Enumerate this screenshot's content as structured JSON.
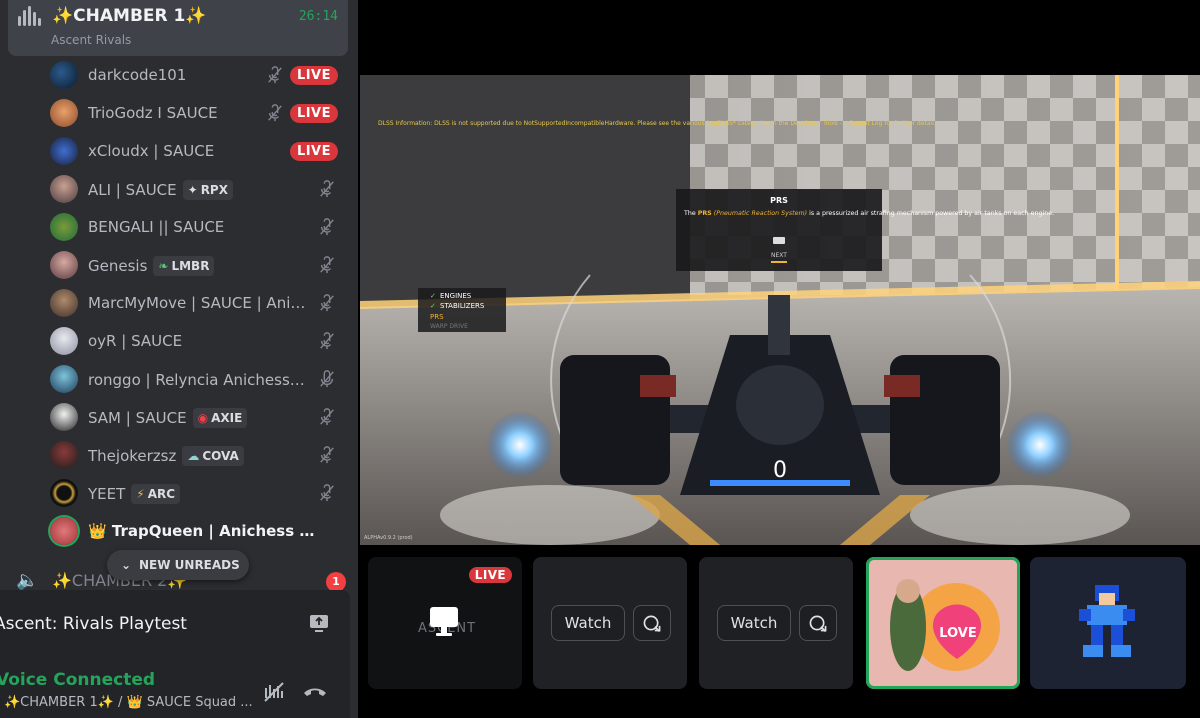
{
  "voice_channel": {
    "name": "✨CHAMBER 1✨",
    "timer": "26:14",
    "activity": "Ascent Rivals"
  },
  "members": [
    {
      "name": "darkcode101",
      "tag": "",
      "tag_glyph": "",
      "live": "LIVE",
      "muted": true
    },
    {
      "name": "TrioGodz I SAUCE",
      "tag": "",
      "tag_glyph": "",
      "live": "LIVE",
      "muted": true
    },
    {
      "name": "xCloudx | SAUCE",
      "tag": "",
      "tag_glyph": "",
      "live": "LIVE",
      "muted": false
    },
    {
      "name": "ALI | SAUCE",
      "tag": "RPX",
      "tag_glyph": "✦",
      "live": "",
      "muted": true
    },
    {
      "name": "BENGALI || SAUCE",
      "tag": "",
      "tag_glyph": "",
      "live": "",
      "muted": true
    },
    {
      "name": "Genesis",
      "tag": "LMBR",
      "tag_glyph": "❧",
      "live": "",
      "muted": true
    },
    {
      "name": "MarcMyMove | SAUCE | Anic...",
      "tag": "",
      "tag_glyph": "",
      "live": "",
      "muted": true
    },
    {
      "name": "oyR | SAUCE",
      "tag": "",
      "tag_glyph": "",
      "live": "",
      "muted": true
    },
    {
      "name": "ronggo | Relyncia Anichess",
      "tag": "",
      "tag_glyph": "✦",
      "live": "",
      "muted": true
    },
    {
      "name": "SAM | SAUCE",
      "tag": "AXIE",
      "tag_glyph": "◉",
      "live": "",
      "muted": true
    },
    {
      "name": "Thejokerzsz",
      "tag": "COVA",
      "tag_glyph": "☁",
      "live": "",
      "muted": true
    },
    {
      "name": "YEET",
      "tag": "ARC",
      "tag_glyph": "⚡",
      "live": "",
      "muted": true
    },
    {
      "name": "👑 TrapQueen | Anichess ✨ SA...",
      "tag": "",
      "tag_glyph": "",
      "live": "",
      "muted": false
    }
  ],
  "new_unreads_label": "NEW UNREADS",
  "channel2": {
    "name": "✨CHAMBER 2✨",
    "unread_count": "1"
  },
  "activity_panel": {
    "title": "Ascent: Rivals Playtest"
  },
  "voice_panel": {
    "status": "Voice Connected",
    "subtitle": "✨CHAMBER 1✨ / 👑 SAUCE Squad ..."
  },
  "video": {
    "dlss_notice": "DLSS Information: DLSS is not supported due to NotSupportedIncompatibleHardware. Please see the various LogDLSS* categories in the Developer Tools -> Output Log for further detail.",
    "tooltip_title": "PRS",
    "tooltip_body_prefix": "The ",
    "tooltip_highlight": "PRS",
    "tooltip_italic": "(Pneumatic Reaction System)",
    "tooltip_body_rest": " is a pressurized air strafing mechanism powered by air tanks on each engine.",
    "tooltip_next": "NEXT",
    "checklist": [
      "ENGINES",
      "STABILIZERS",
      "PRS",
      "WARP DRIVE"
    ],
    "speed": "0",
    "build": "ALPHAv0.9.2 (prod)"
  },
  "tiles": {
    "t1_live": "LIVE",
    "t1_label": "ASCENT",
    "watch_label": "Watch",
    "love_label": "LOVE"
  },
  "colors": {
    "sidebar_bg": "#2b2d31",
    "live_red": "#da373c",
    "connected_green": "#23a55a"
  }
}
